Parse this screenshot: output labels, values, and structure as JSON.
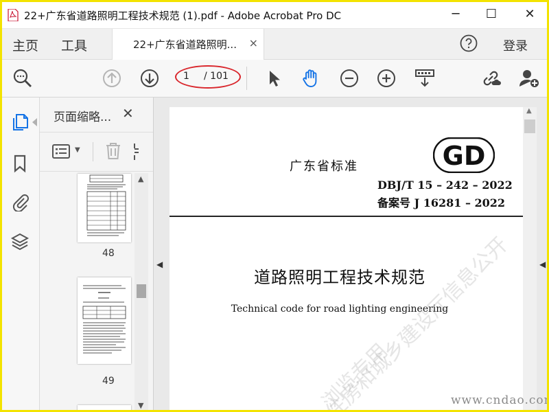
{
  "window": {
    "title": "22+广东省道路照明工程技术规范 (1).pdf - Adobe Acrobat Pro DC",
    "controls": [
      "─",
      "☐",
      "✕"
    ]
  },
  "nav": {
    "home": "主页",
    "tools": "工具",
    "document_tab": "22+广东省道路照明...",
    "tab_close": "×",
    "login": "登录"
  },
  "toolbar": {
    "current_page": "1",
    "total_pages": "/ 101"
  },
  "sidebar": {
    "panel_title": "页面缩略...",
    "close": "✕",
    "thumbnails": [
      {
        "page": "48"
      },
      {
        "page": "49"
      }
    ]
  },
  "document": {
    "standard_label": "广东省标准",
    "logo": "GD",
    "standard_number": "DBJ/T 15 – 242 – 2022",
    "record_number": "备案号 J 16281 – 2022",
    "title_cn": "道路照明工程技术规范",
    "title_en": "Technical code for road lighting engineering"
  },
  "watermarks": {
    "diagonal_1": "住房和城乡建设厅信息公开",
    "diagonal_2": "浏览专用",
    "site": "www.cndao.com"
  },
  "colors": {
    "frame": "#f3e300",
    "annotation_ellipse": "#d9262c",
    "active_icon": "#1473e6"
  }
}
